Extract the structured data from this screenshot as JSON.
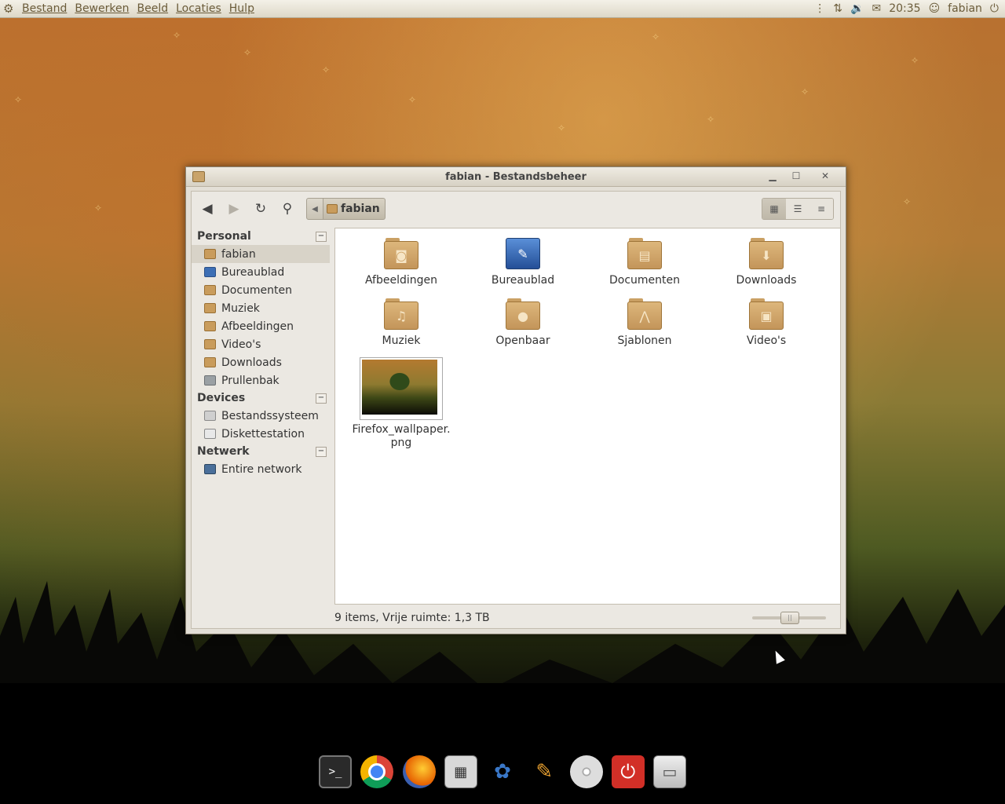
{
  "top_panel": {
    "menus": [
      "Bestand",
      "Bewerken",
      "Beeld",
      "Locaties",
      "Hulp"
    ],
    "clock": "20:35",
    "user": "fabian"
  },
  "window": {
    "title": "fabian - Bestandsbeheer",
    "path_button": "fabian"
  },
  "sidebar": {
    "personal": {
      "heading": "Personal",
      "items": [
        {
          "label": "fabian",
          "icon": "home-folder-icon"
        },
        {
          "label": "Bureaublad",
          "icon": "desktop-icon"
        },
        {
          "label": "Documenten",
          "icon": "documents-folder-icon"
        },
        {
          "label": "Muziek",
          "icon": "music-folder-icon"
        },
        {
          "label": "Afbeeldingen",
          "icon": "pictures-folder-icon"
        },
        {
          "label": "Video's",
          "icon": "videos-folder-icon"
        },
        {
          "label": "Downloads",
          "icon": "downloads-folder-icon"
        },
        {
          "label": "Prullenbak",
          "icon": "trash-icon"
        }
      ]
    },
    "devices": {
      "heading": "Devices",
      "items": [
        {
          "label": "Bestandssysteem",
          "icon": "drive-icon"
        },
        {
          "label": "Diskettestation",
          "icon": "floppy-icon"
        }
      ]
    },
    "network": {
      "heading": "Netwerk",
      "items": [
        {
          "label": "Entire network",
          "icon": "network-icon"
        }
      ]
    }
  },
  "files": [
    {
      "name": "Afbeeldingen",
      "icon": "pictures-folder-icon",
      "glyph": "◙"
    },
    {
      "name": "Bureaublad",
      "icon": "desktop-icon",
      "glyph": "✎"
    },
    {
      "name": "Documenten",
      "icon": "documents-folder-icon",
      "glyph": "▤"
    },
    {
      "name": "Downloads",
      "icon": "downloads-folder-icon",
      "glyph": "⬇"
    },
    {
      "name": "Muziek",
      "icon": "music-folder-icon",
      "glyph": "♫"
    },
    {
      "name": "Openbaar",
      "icon": "public-folder-icon",
      "glyph": "●"
    },
    {
      "name": "Sjablonen",
      "icon": "templates-folder-icon",
      "glyph": "⋀"
    },
    {
      "name": "Video's",
      "icon": "videos-folder-icon",
      "glyph": "▣"
    },
    {
      "name": "Firefox_wallpaper.\npng",
      "icon": "image-thumbnail"
    }
  ],
  "status": {
    "text": "9 items, Vrije ruimte: 1,3 TB"
  },
  "dock": [
    "terminal-icon",
    "chrome-icon",
    "firefox-icon",
    "calculator-icon",
    "gnome-icon",
    "paint-icon",
    "cd-icon",
    "power-icon",
    "file-manager-icon"
  ]
}
